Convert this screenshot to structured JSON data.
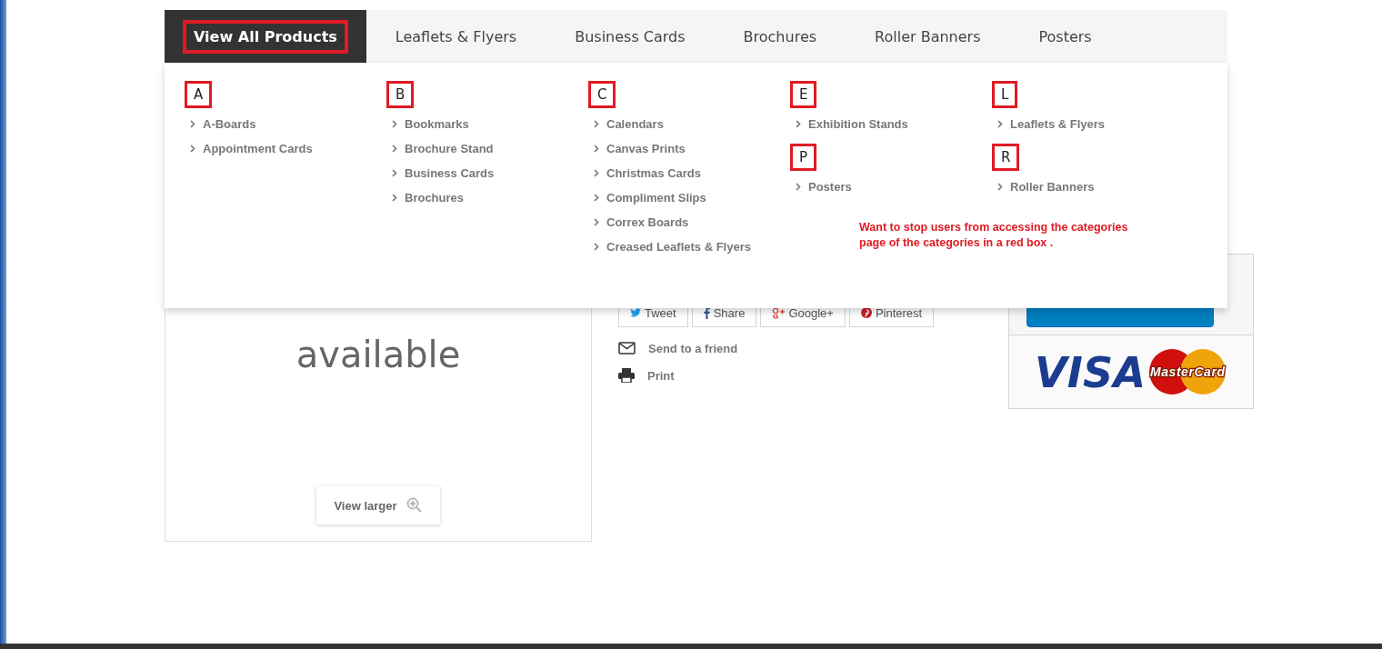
{
  "nav": {
    "tabs": [
      {
        "label": "View All Products",
        "selected": true,
        "highlighted": true
      },
      {
        "label": "Leaflets & Flyers",
        "selected": false,
        "highlighted": false
      },
      {
        "label": "Business Cards",
        "selected": false,
        "highlighted": false
      },
      {
        "label": "Brochures",
        "selected": false,
        "highlighted": false
      },
      {
        "label": "Roller Banners",
        "selected": false,
        "highlighted": false
      },
      {
        "label": "Posters",
        "selected": false,
        "highlighted": false
      }
    ]
  },
  "dropdown": {
    "columns": [
      {
        "groups": [
          {
            "letter": "A",
            "highlighted": true,
            "items": [
              "A-Boards",
              "Appointment Cards"
            ]
          }
        ]
      },
      {
        "groups": [
          {
            "letter": "B",
            "highlighted": true,
            "items": [
              "Bookmarks",
              "Brochure Stand",
              "Business Cards",
              "Brochures"
            ]
          }
        ]
      },
      {
        "groups": [
          {
            "letter": "C",
            "highlighted": true,
            "items": [
              "Calendars",
              "Canvas Prints",
              "Christmas Cards",
              "Compliment Slips",
              "Correx Boards",
              "Creased Leaflets & Flyers"
            ]
          }
        ]
      },
      {
        "groups": [
          {
            "letter": "E",
            "highlighted": true,
            "items": [
              "Exhibition Stands"
            ]
          },
          {
            "letter": "P",
            "highlighted": true,
            "items": [
              "Posters"
            ]
          }
        ]
      },
      {
        "groups": [
          {
            "letter": "L",
            "highlighted": true,
            "items": [
              "Leaflets & Flyers"
            ]
          },
          {
            "letter": "R",
            "highlighted": true,
            "items": [
              "Roller Banners"
            ]
          }
        ]
      }
    ],
    "annotation": "Want to stop users from accessing the categories page of the categories in a red box ."
  },
  "product_image": {
    "lines": [
      "available"
    ],
    "view_larger": "View larger"
  },
  "share_buttons": [
    {
      "kind": "twitter",
      "label": "Tweet"
    },
    {
      "kind": "facebook",
      "label": "Share"
    },
    {
      "kind": "google",
      "label": "Google+"
    },
    {
      "kind": "pinterest",
      "label": "Pinterest"
    }
  ],
  "actions": [
    {
      "kind": "mail",
      "label": "Send to a friend"
    },
    {
      "kind": "print",
      "label": "Print"
    }
  ],
  "payment_logos": [
    "VISA",
    "MasterCard"
  ]
}
